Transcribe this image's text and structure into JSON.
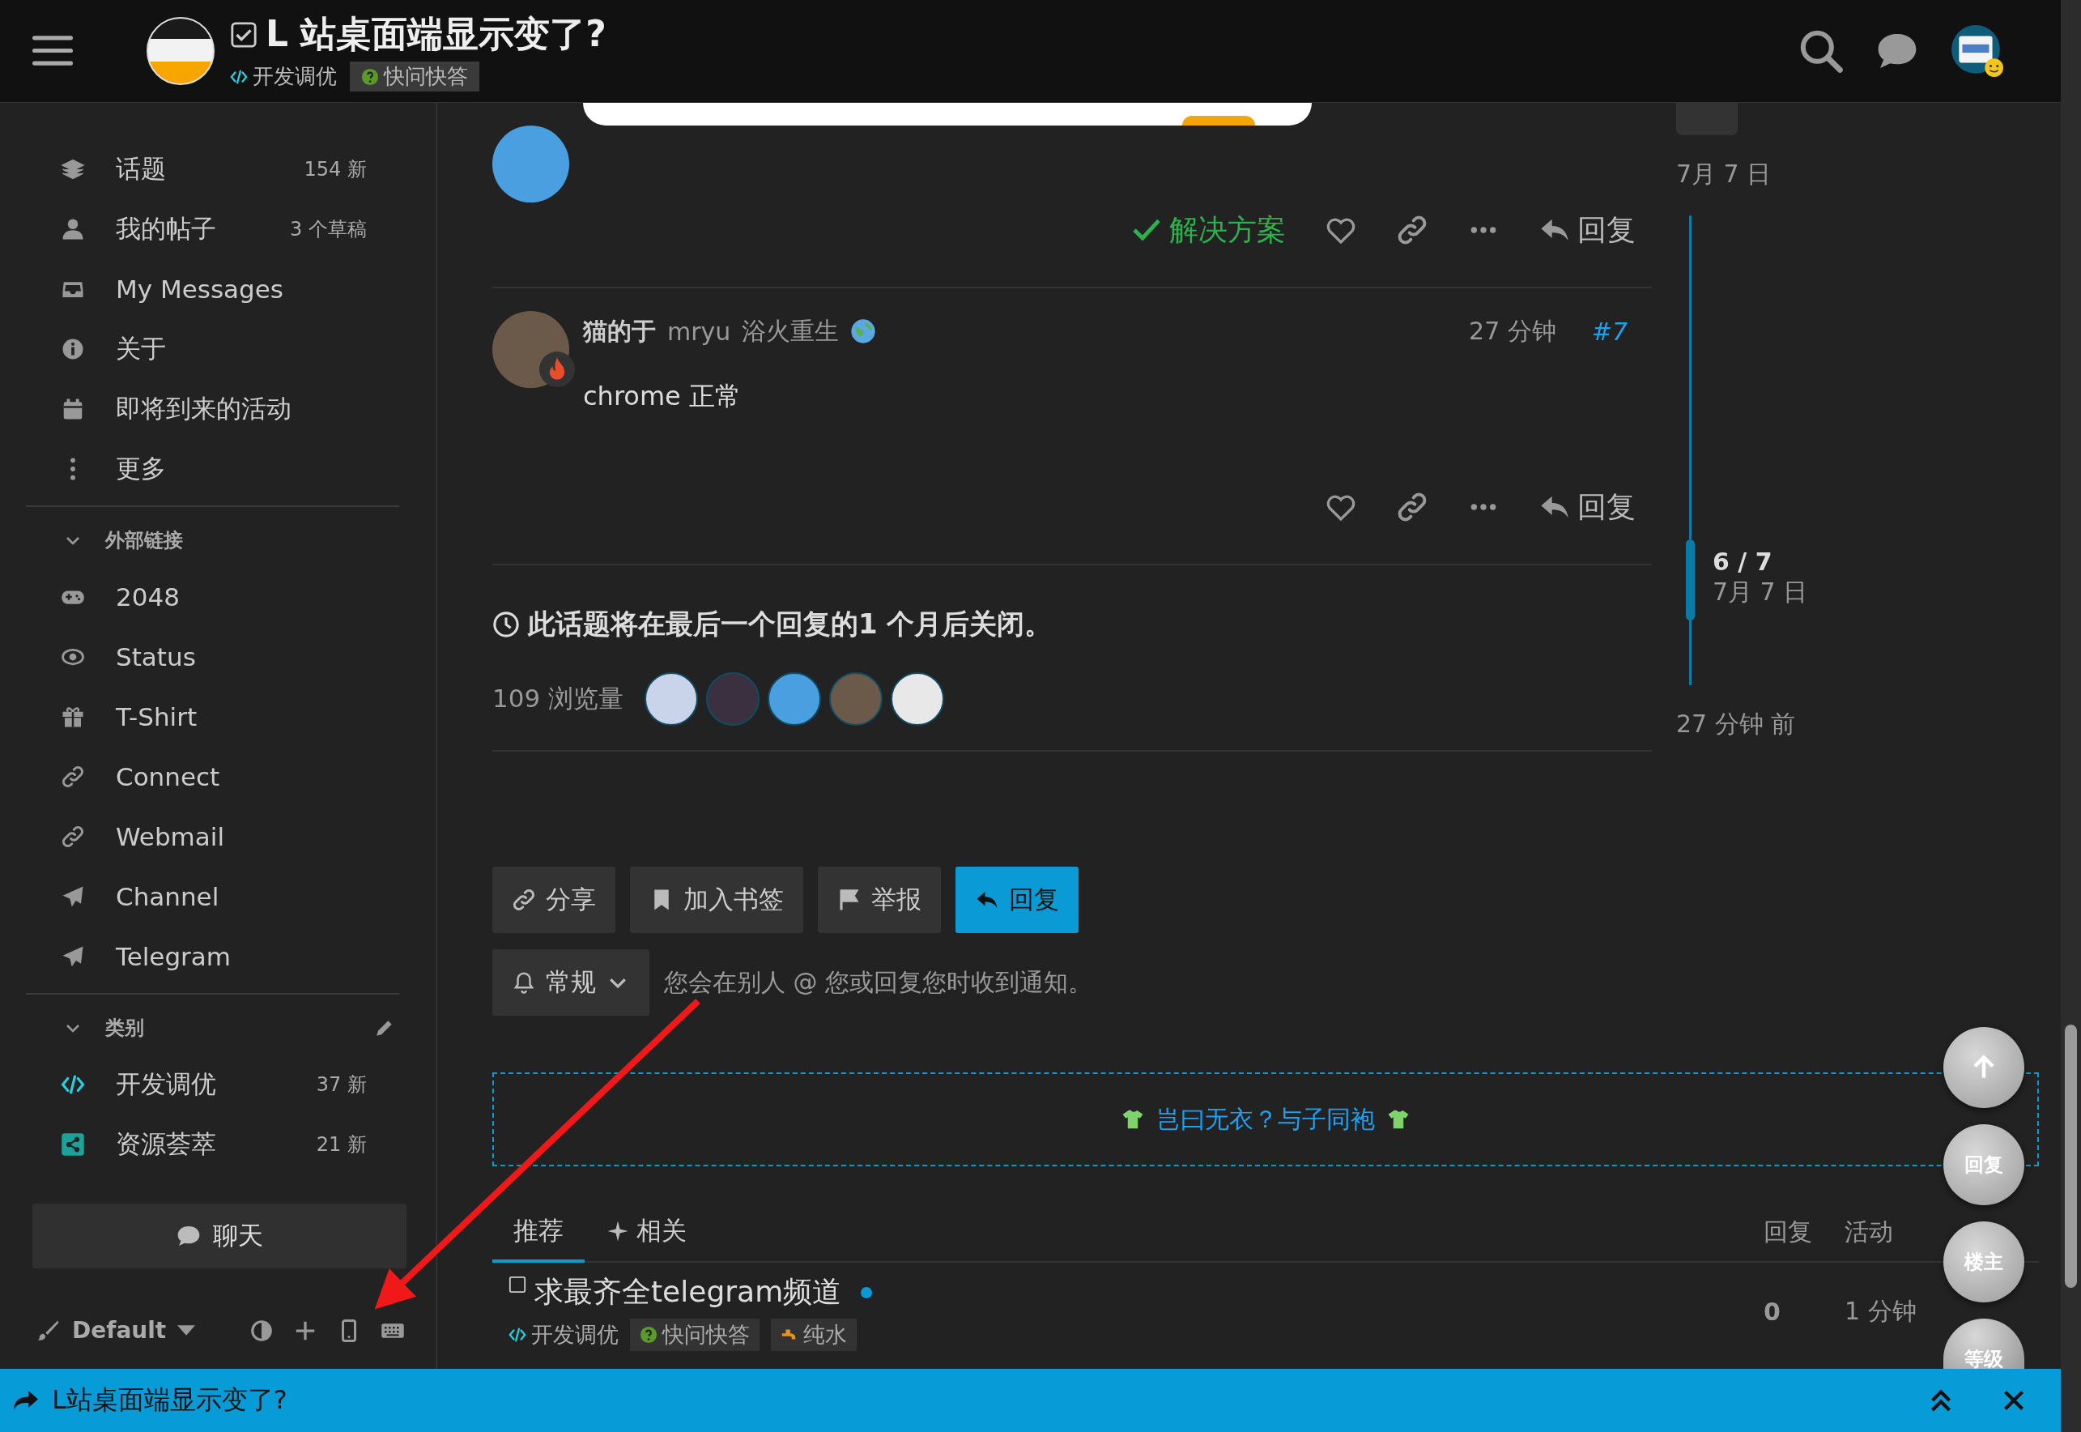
{
  "header": {
    "title": "L 站桌面端显示变了?",
    "category": "开发调优",
    "tag": "快问快答"
  },
  "sidebar": {
    "items": [
      {
        "label": "话题",
        "count": "154 新"
      },
      {
        "label": "我的帖子",
        "count": "3 个草稿"
      },
      {
        "label": "My Messages"
      },
      {
        "label": "关于"
      },
      {
        "label": "即将到来的活动"
      },
      {
        "label": "更多"
      }
    ],
    "external_links": {
      "title": "外部链接",
      "expanded": true,
      "items": [
        {
          "label": "2048"
        },
        {
          "label": "Status"
        },
        {
          "label": "T-Shirt"
        },
        {
          "label": "Connect"
        },
        {
          "label": "Webmail"
        },
        {
          "label": "Channel"
        },
        {
          "label": "Telegram"
        }
      ]
    },
    "categories": {
      "title": "类别",
      "expanded": true,
      "items": [
        {
          "label": "开发调优",
          "count": "37 新",
          "color": "#25d0e0"
        },
        {
          "label": "资源荟萃",
          "count": "21 新",
          "color": "#1aa39a"
        }
      ]
    },
    "chat_button": "聊天",
    "theme": "Default"
  },
  "posts": [
    {
      "actions": {
        "solution": "解决方案",
        "reply": "回复"
      }
    },
    {
      "name": "猫的于",
      "username": "mryu",
      "user_title": "浴火重生",
      "time": "27 分钟",
      "number": "#7",
      "body": "chrome 正常",
      "actions": {
        "reply": "回复"
      }
    }
  ],
  "closing_notice": "此话题将在最后一个回复的1 个月后关闭。",
  "views": "109 浏览量",
  "footer_buttons": [
    {
      "label": "分享",
      "primary": false
    },
    {
      "label": "加入书签",
      "primary": false
    },
    {
      "label": "举报",
      "primary": false
    },
    {
      "label": "回复",
      "primary": true
    }
  ],
  "notification": {
    "level": "常规",
    "text": "您会在别人 @ 您或回复您时收到通知。"
  },
  "banner": "岂曰无衣？与子同袍",
  "suggested": {
    "tabs": [
      {
        "label": "推荐",
        "selected": true
      },
      {
        "label": "相关",
        "selected": false
      }
    ],
    "columns": [
      "回复",
      "活动"
    ],
    "rows": [
      {
        "title": "求最齐全telegram频道",
        "unread": true,
        "category": "开发调优",
        "tags": [
          {
            "label": "快问快答",
            "kind": "question",
            "color": "#5a9a2a"
          },
          {
            "label": "纯水",
            "kind": "faucet",
            "color": "#e8921e"
          }
        ],
        "replies": "0",
        "activity": "1 分钟"
      }
    ]
  },
  "timeline": {
    "start_date": "7月 7 日",
    "position": "6 / 7",
    "current_date": "7月 7 日",
    "end": "27 分钟 前"
  },
  "floating_buttons": [
    "回复",
    "楼主",
    "等级"
  ],
  "bottom_bar": {
    "title": "L站桌面端显示变了?"
  }
}
